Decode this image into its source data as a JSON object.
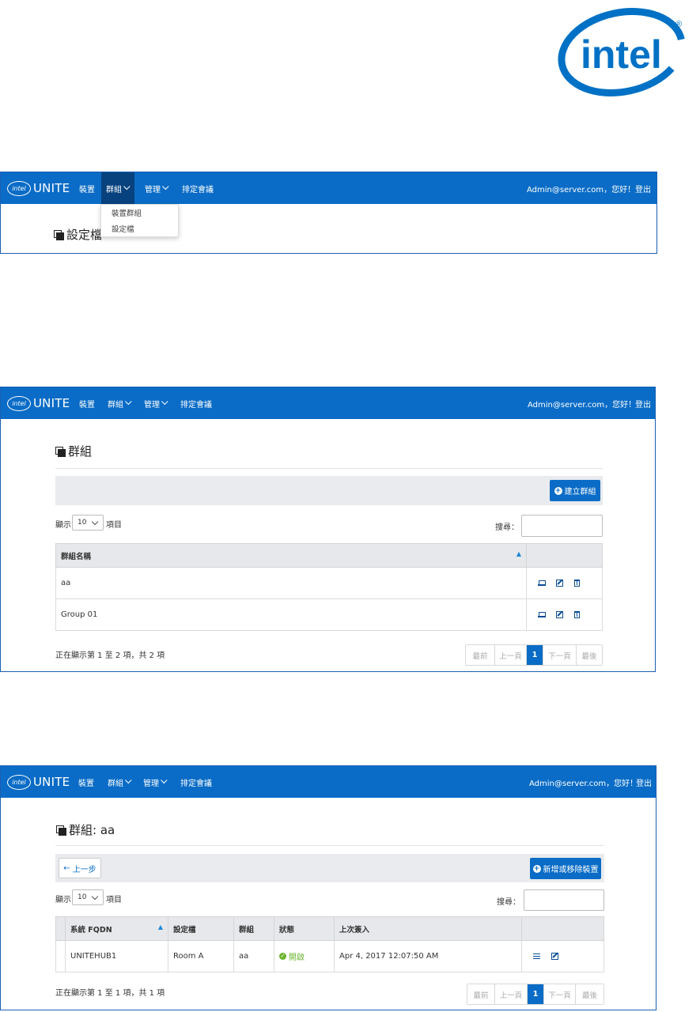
{
  "logo": {
    "text": "intel",
    "registered": "®",
    "color": "#0071c5"
  },
  "brand": {
    "badge": "intel",
    "name": "UNITE"
  },
  "nav": {
    "devices": "裝置",
    "groups": "群組",
    "manage": "管理",
    "schedule": "排定會議",
    "greeting": "Admin@server.com，您好！",
    "logout": "登出"
  },
  "panel1": {
    "title": "設定檔",
    "dropdown": [
      "裝置群組",
      "設定檔"
    ]
  },
  "panel2": {
    "title": "群組",
    "create_button": "建立群組",
    "show_label": "顯示",
    "show_value": "10",
    "items_label": "項目",
    "search_label": "搜尋：",
    "column_name": "群組名稱",
    "rows": [
      {
        "name": "aa"
      },
      {
        "name": "Group 01"
      }
    ],
    "info": "正在顯示第 1 至 2 項，共 2 項",
    "pager": [
      "最前",
      "上一頁",
      "1",
      "下一頁",
      "最後"
    ]
  },
  "panel3": {
    "title": "群組: aa",
    "back_button": "上一步",
    "add_remove_button": "新增或移除裝置",
    "show_label": "顯示",
    "show_value": "10",
    "items_label": "項目",
    "search_label": "搜尋：",
    "columns": [
      "系統 FQDN",
      "設定檔",
      "群組",
      "狀態",
      "上次簽入"
    ],
    "rows": [
      {
        "fqdn": "UNITEHUB1",
        "profile": "Room A",
        "group": "aa",
        "status": "開啟",
        "checkin": "Apr 4, 2017 12:07:50 AM"
      }
    ],
    "info": "正在顯示第 1 至 1 項，共 1 項",
    "pager": [
      "最前",
      "上一頁",
      "1",
      "下一頁",
      "最後"
    ]
  },
  "colors": {
    "navbar": "#0a6cc6",
    "active_nav": "#08427e",
    "status_on": "#6ab42d"
  }
}
